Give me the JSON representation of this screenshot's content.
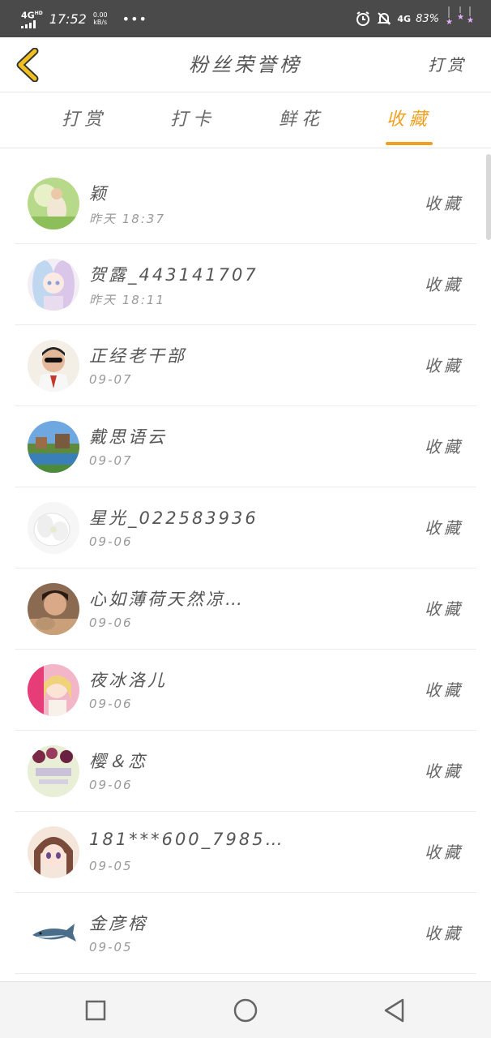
{
  "status_bar": {
    "network": "4G",
    "network_sup": "HD",
    "time": "17:52",
    "speed_value": "0.00",
    "speed_unit": "kB/s",
    "dots": "•••",
    "net2": "4G",
    "battery": "83%"
  },
  "header": {
    "title": "粉丝荣誉榜",
    "action": "打赏"
  },
  "tabs": [
    {
      "label": "打赏",
      "active": false
    },
    {
      "label": "打卡",
      "active": false
    },
    {
      "label": "鲜花",
      "active": false
    },
    {
      "label": "收藏",
      "active": true
    }
  ],
  "list": [
    {
      "name": "颖",
      "time": "昨天 18:37",
      "action": "收藏"
    },
    {
      "name": "贺露_443141707",
      "time": "昨天 18:11",
      "action": "收藏"
    },
    {
      "name": "正经老干部",
      "time": "09-07",
      "action": "收藏"
    },
    {
      "name": "戴思语云",
      "time": "09-07",
      "action": "收藏"
    },
    {
      "name": "星光_022583936",
      "time": "09-06",
      "action": "收藏"
    },
    {
      "name": "心如薄荷天然凉…",
      "time": "09-06",
      "action": "收藏"
    },
    {
      "name": "夜冰洛儿",
      "time": "09-06",
      "action": "收藏"
    },
    {
      "name": "樱＆恋",
      "time": "09-06",
      "action": "收藏"
    },
    {
      "name": "181***600_7985…",
      "time": "09-05",
      "action": "收藏"
    },
    {
      "name": "金彦榕",
      "time": "09-05",
      "action": "收藏"
    }
  ],
  "colors": {
    "accent": "#f0a020",
    "status_bar": "#4a4a4a",
    "back_icon": "#f0c020"
  }
}
